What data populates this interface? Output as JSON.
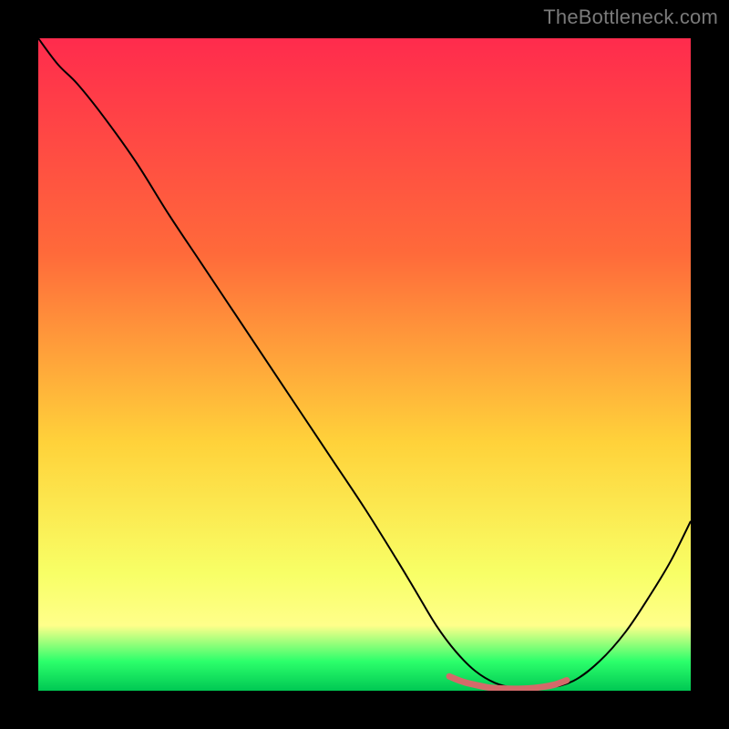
{
  "watermark": "TheBottleneck.com",
  "colors": {
    "frame": "#000000",
    "grad_top": "#ff2b4d",
    "grad_mid_upper": "#ff6a3a",
    "grad_mid": "#ffd23a",
    "grad_lower": "#f8ff66",
    "grad_bottom_yellow": "#ffff8a",
    "grad_green": "#2cff6b",
    "grad_green_deep": "#00c853",
    "curve_color": "#000000",
    "highlight_color": "#d46a6a"
  },
  "chart_data": {
    "type": "line",
    "title": "",
    "xlabel": "",
    "ylabel": "",
    "xlim": [
      0,
      100
    ],
    "ylim": [
      0,
      100
    ],
    "series": [
      {
        "name": "bottleneck-curve",
        "x": [
          0,
          3,
          6,
          10,
          15,
          20,
          25,
          30,
          35,
          40,
          45,
          50,
          55,
          58,
          61,
          64,
          67,
          70,
          73,
          75,
          78,
          82,
          86,
          90,
          94,
          97,
          100
        ],
        "y": [
          100,
          96,
          93,
          88,
          81,
          73,
          65.5,
          58,
          50.5,
          43,
          35.5,
          28,
          20,
          15,
          10,
          6,
          3,
          1.2,
          0.4,
          0.3,
          0.4,
          1.5,
          4.5,
          9,
          15,
          20,
          26
        ]
      },
      {
        "name": "optimal-range-highlight",
        "x": [
          63,
          65,
          67,
          69,
          71,
          73,
          75,
          77,
          79,
          81
        ],
        "y": [
          2.2,
          1.4,
          0.9,
          0.5,
          0.35,
          0.3,
          0.35,
          0.55,
          0.9,
          1.6
        ]
      }
    ],
    "gradient_stops": [
      {
        "offset": 0.0,
        "name": "grad_top"
      },
      {
        "offset": 0.33,
        "name": "grad_mid_upper"
      },
      {
        "offset": 0.62,
        "name": "grad_mid"
      },
      {
        "offset": 0.82,
        "name": "grad_lower"
      },
      {
        "offset": 0.9,
        "name": "grad_bottom_yellow"
      },
      {
        "offset": 0.955,
        "name": "grad_green"
      },
      {
        "offset": 1.0,
        "name": "grad_green_deep"
      }
    ]
  }
}
